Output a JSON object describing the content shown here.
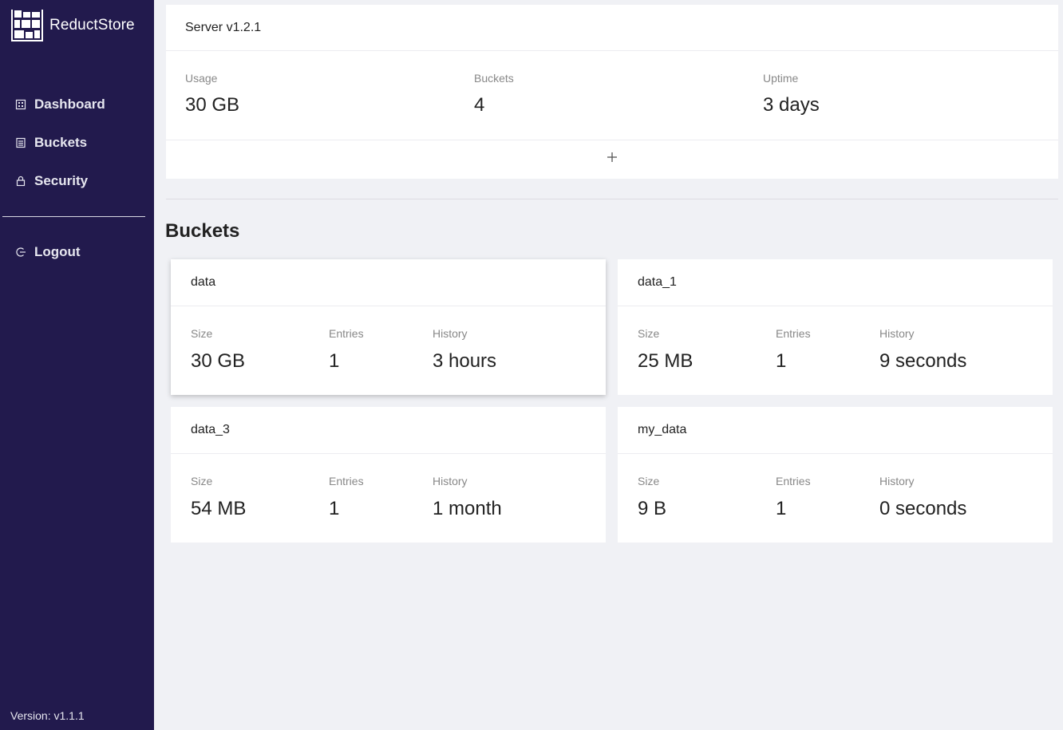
{
  "app": {
    "name": "ReductStore",
    "version": "Version: v1.1.1"
  },
  "sidebar": {
    "items": [
      {
        "label": "Dashboard",
        "icon": "dashboard-icon"
      },
      {
        "label": "Buckets",
        "icon": "bucket-list-icon"
      },
      {
        "label": "Security",
        "icon": "lock-icon"
      },
      {
        "label": "Logout",
        "icon": "logout-icon"
      }
    ]
  },
  "server": {
    "title": "Server v1.2.1",
    "stats": [
      {
        "label": "Usage",
        "value": "30 GB"
      },
      {
        "label": "Buckets",
        "value": "4"
      },
      {
        "label": "Uptime",
        "value": "3 days"
      }
    ],
    "add_icon": "plus-icon"
  },
  "buckets_section": {
    "title": "Buckets",
    "columns": [
      "Size",
      "Entries",
      "History"
    ],
    "items": [
      {
        "name": "data",
        "size": "30 GB",
        "entries": "1",
        "history": "3 hours"
      },
      {
        "name": "data_1",
        "size": "25 MB",
        "entries": "1",
        "history": "9 seconds"
      },
      {
        "name": "data_3",
        "size": "54 MB",
        "entries": "1",
        "history": "1 month"
      },
      {
        "name": "my_data",
        "size": "9 B",
        "entries": "1",
        "history": "0 seconds"
      }
    ]
  },
  "colors": {
    "sidebar_bg": "#221a4d",
    "page_bg": "#f0f1f5",
    "card_bg": "#ffffff",
    "muted_text": "#888888"
  }
}
